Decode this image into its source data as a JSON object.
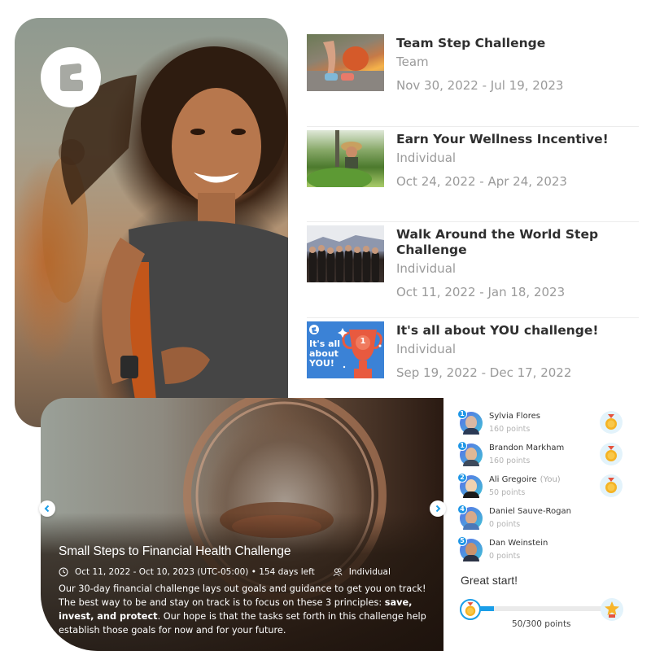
{
  "hero": {
    "logo_icon": "brand-e-logo-icon",
    "photo_description": "smiling woman running"
  },
  "challenges": [
    {
      "title": "Team Step Challenge",
      "type": "Team",
      "dates": "Nov 30, 2022 - Jul 19, 2023",
      "thumbnail": "tying-running-shoes"
    },
    {
      "title": "Earn Your Wellness Incentive!",
      "type": "Individual",
      "dates": "Oct 24, 2022 - Apr 24, 2023",
      "thumbnail": "woman-gardening"
    },
    {
      "title": "Walk Around the World Step Challenge",
      "type": "Individual",
      "dates": "Oct 11, 2022 - Jan 18, 2023",
      "thumbnail": "group-arms-linked-mountains"
    },
    {
      "title": "It's all about YOU challenge!",
      "type": "Individual",
      "dates": "Sep 19, 2022 - Dec 17, 2022",
      "thumbnail": "trophy-banner",
      "thumbnail_text": [
        "It's all",
        "about",
        "YOU!"
      ],
      "thumbnail_trophy_number": "1"
    }
  ],
  "featured": {
    "title": "Small Steps to Financial Health Challenge",
    "dates": "Oct 11, 2022 - Oct 10, 2023 (UTC-05:00) • 154 days left",
    "type": "Individual",
    "description_parts": [
      "Our 30-day financial challenge lays out goals and guidance to get you on track! The best way to be and stay on track is to focus on these 3 principles: ",
      "save, invest, and protect",
      ". Our hope is that the tasks set forth in this challenge help establish those goals for now and for your future."
    ],
    "prev_icon": "chevron-left-icon",
    "next_icon": "chevron-right-icon"
  },
  "leaderboard": {
    "entries": [
      {
        "rank": "1",
        "name": "Sylvia Flores",
        "you": "",
        "points": "160 points",
        "medal": true
      },
      {
        "rank": "1",
        "name": "Brandon Markham",
        "you": "",
        "points": "160 points",
        "medal": true
      },
      {
        "rank": "2",
        "name": "Ali Gregoire",
        "you": "(You)",
        "points": "50 points",
        "medal": true
      },
      {
        "rank": "4",
        "name": "Daniel Sauve-Rogan",
        "you": "",
        "points": "0 points",
        "medal": false
      },
      {
        "rank": "5",
        "name": "Dan Weinstein",
        "you": "",
        "points": "0 points",
        "medal": false
      }
    ]
  },
  "progress": {
    "title": "Great start!",
    "current": 50,
    "goal": 300,
    "fraction": 0.1667,
    "label": "50/300 points",
    "accent": "#1a9ee8"
  },
  "colors": {
    "accent_blue": "#1a9ee8",
    "title_text": "#2f2f2f",
    "muted_text": "#9a9a9a",
    "medal_gold": "#f5b324",
    "medal_ribbon": "#e5533d"
  }
}
